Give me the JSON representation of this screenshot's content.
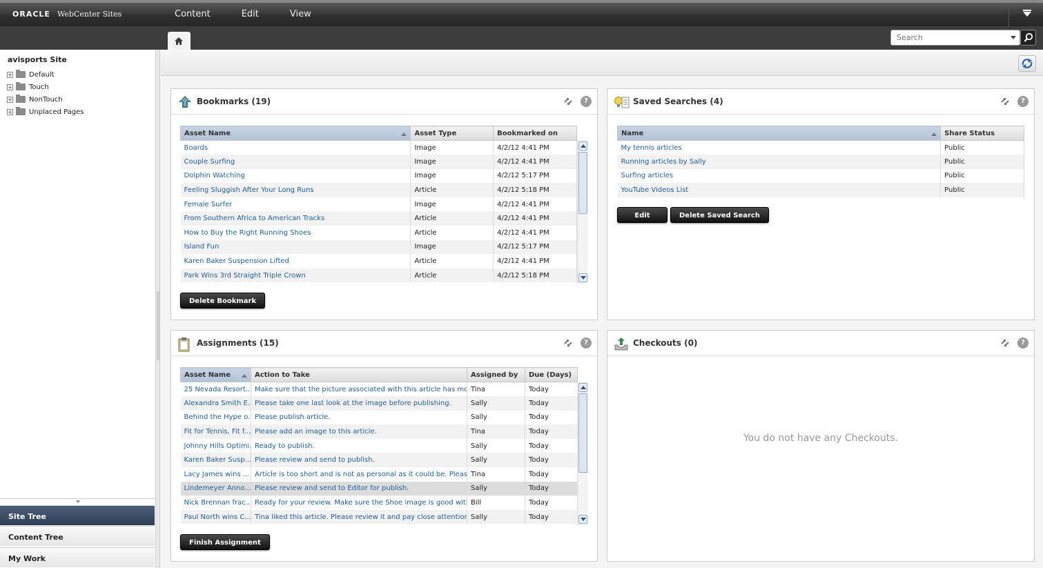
{
  "app": {
    "brand": "ORACLE",
    "product": "WebCenter Sites"
  },
  "topmenu": [
    "Content",
    "Edit",
    "View"
  ],
  "search": {
    "placeholder": "Search"
  },
  "site": {
    "title": "avisports Site",
    "tree": [
      "Default",
      "Touch",
      "NonTouch",
      "Unplaced Pages"
    ]
  },
  "nav": {
    "site_tree": "Site Tree",
    "content_tree": "Content Tree",
    "my_work": "My Work"
  },
  "bookmarks": {
    "title": "Bookmarks (19)",
    "columns": [
      "Asset Name",
      "Asset Type",
      "Bookmarked on"
    ],
    "rows": [
      [
        "Boards",
        "Image",
        "4/2/12 4:41 PM"
      ],
      [
        "Couple Surfing",
        "Image",
        "4/2/12 4:41 PM"
      ],
      [
        "Dolphin Watching",
        "Image",
        "4/2/12 5:17 PM"
      ],
      [
        "Feeling Sluggish After Your Long Runs",
        "Article",
        "4/2/12 5:18 PM"
      ],
      [
        "Female Surfer",
        "Image",
        "4/2/12 4:41 PM"
      ],
      [
        "From Southern Africa to American Tracks",
        "Article",
        "4/2/12 4:41 PM"
      ],
      [
        "How to Buy the Right Running Shoes",
        "Article",
        "4/2/12 4:41 PM"
      ],
      [
        "Island Fun",
        "Image",
        "4/2/12 5:17 PM"
      ],
      [
        "Karen Baker Suspension Lifted",
        "Article",
        "4/2/12 4:41 PM"
      ],
      [
        "Park Wins 3rd Straight Triple Crown",
        "Article",
        "4/2/12 5:18 PM"
      ]
    ],
    "button": "Delete Bookmark"
  },
  "saved_searches": {
    "title": "Saved Searches (4)",
    "columns": [
      "Name",
      "Share Status"
    ],
    "rows": [
      [
        "My tennis articles",
        "Public"
      ],
      [
        "Running articles by Sally",
        "Public"
      ],
      [
        "Surfing articles",
        "Public"
      ],
      [
        "YouTube Videos List",
        "Public"
      ]
    ],
    "edit_button": "Edit",
    "delete_button": "Delete Saved Search"
  },
  "assignments": {
    "title": "Assignments (15)",
    "columns": [
      "Asset Name",
      "Action to Take",
      "Assigned by",
      "Due (Days)"
    ],
    "rows": [
      [
        "25 Nevada Resort...",
        "Make sure that the picture associated with this article has more pe...",
        "Tina",
        "Today"
      ],
      [
        "Alexandra Smith E...",
        "Please take one last look at the image before publishing.",
        "Sally",
        "Today"
      ],
      [
        "Behind the Hype o...",
        "Please publish article.",
        "Sally",
        "Today"
      ],
      [
        "Fit for Tennis, Fit f...",
        "Please add an image to this article.",
        "Tina",
        "Today"
      ],
      [
        "Johnny Hills Optimi...",
        "Ready to publish.",
        "Sally",
        "Today"
      ],
      [
        "Karen Baker Susp...",
        "Please review and send to publish.",
        "Sally",
        "Today"
      ],
      [
        "Lacy James wins ...",
        "Article is too short and is not as personal as it could be. Please ma...",
        "Tina",
        "Today"
      ],
      [
        "Lindemeyer Anno...",
        "Please review and send to Editor for publish.",
        "Sally",
        "Today"
      ],
      [
        "Nick Brennan frac...",
        "Ready for your review. Make sure the Shoe image is good with you.",
        "Bill",
        "Today"
      ],
      [
        "Paul North wins C...",
        "Tina liked this article. Please review it and pay close attention to the...",
        "Sally",
        "Today"
      ]
    ],
    "button": "Finish Assignment"
  },
  "checkouts": {
    "title": "Checkouts (0)",
    "empty": "You do not have any Checkouts."
  },
  "icons": {
    "home": "home-icon",
    "search": "magnifier-icon",
    "refresh": "refresh-arrows-icon",
    "help": "question-icon",
    "bookmarks": "bookmark-arrow-icon",
    "saved_searches": "lightbulb-list-icon",
    "assignments": "clipboard-icon",
    "checkouts": "upload-tray-icon"
  },
  "colors": {
    "link": "#1f5e9f",
    "nav_active": "#2f3e55",
    "topbar": "#2e2e2e"
  }
}
